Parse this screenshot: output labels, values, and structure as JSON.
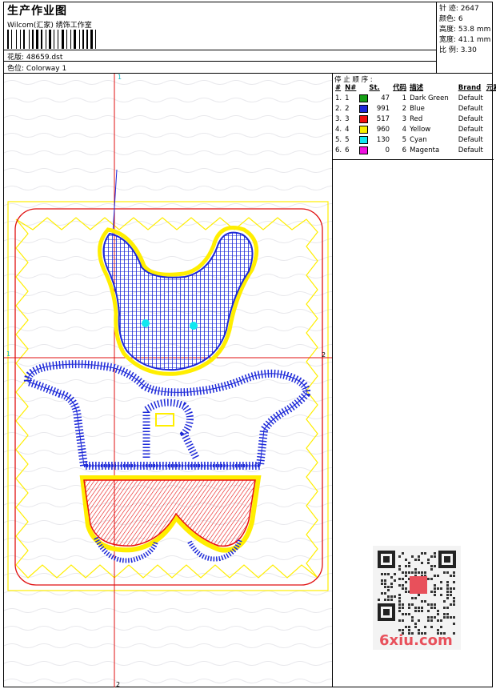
{
  "header": {
    "title": "生产作业图",
    "company": "Wilcom(汇家) 绣饰工作室",
    "design_label": "花版",
    "design_value": "48659.dst",
    "colorway_label": "色位",
    "colorway_value": "Colorway 1"
  },
  "stats": [
    {
      "label": "针 迹",
      "value": "2647"
    },
    {
      "label": "颜色",
      "value": "6"
    },
    {
      "label": "高度",
      "value": "53.8 mm"
    },
    {
      "label": "宽度",
      "value": "41.1 mm"
    },
    {
      "label": "比 例",
      "value": "3.30"
    }
  ],
  "stop_sequence": {
    "title": "停 止 顺 序 :",
    "headers": [
      "#",
      "N#",
      "St.",
      "代码",
      "描述",
      "Brand",
      "元素"
    ],
    "rows": [
      {
        "n": "1.",
        "code_num": "1",
        "color": "#16a016",
        "stitches": "47",
        "code": "1",
        "desc": "Dark Green",
        "brand": "Default"
      },
      {
        "n": "2.",
        "code_num": "2",
        "color": "#1c28d8",
        "stitches": "991",
        "code": "2",
        "desc": "Blue",
        "brand": "Default"
      },
      {
        "n": "3.",
        "code_num": "3",
        "color": "#f01010",
        "stitches": "517",
        "code": "3",
        "desc": "Red",
        "brand": "Default"
      },
      {
        "n": "4.",
        "code_num": "4",
        "color": "#f8f000",
        "stitches": "960",
        "code": "4",
        "desc": "Yellow",
        "brand": "Default"
      },
      {
        "n": "5.",
        "code_num": "5",
        "color": "#10e8f0",
        "stitches": "130",
        "code": "5",
        "desc": "Cyan",
        "brand": "Default"
      },
      {
        "n": "6.",
        "code_num": "6",
        "color": "#f010e0",
        "stitches": "0",
        "code": "6",
        "desc": "Magenta",
        "brand": "Default"
      }
    ]
  },
  "axis_labels": {
    "top": "1",
    "left": "1",
    "right": "2",
    "bottom": "2"
  },
  "watermark": "6xiu.com",
  "colors": {
    "guide": "#e01010",
    "outline": "#ffee00",
    "blue": "#1c28d8",
    "red": "#f01010"
  }
}
